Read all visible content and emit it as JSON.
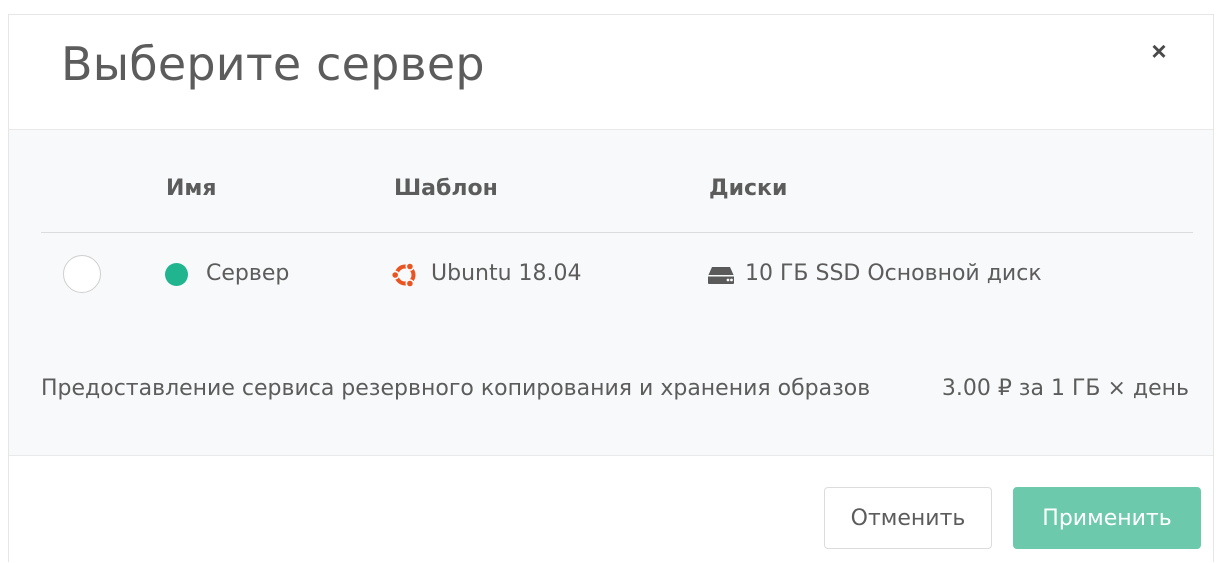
{
  "dialog": {
    "title": "Выберите сервер",
    "close_label": "×"
  },
  "table": {
    "headers": {
      "name": "Имя",
      "template": "Шаблон",
      "disks": "Диски"
    },
    "rows": [
      {
        "selected": false,
        "status_color": "#20b58f",
        "status_icon": "status-dot-active",
        "name": "Сервер",
        "template_icon": "ubuntu-icon",
        "template": "Ubuntu 18.04",
        "disk_icon": "hard-drive-icon",
        "disk": "10 ГБ SSD Основной диск"
      }
    ]
  },
  "service": {
    "label": "Предоставление сервиса резервного копирования и хранения образов",
    "price": "3.00 ₽  за 1 ГБ × день"
  },
  "footer": {
    "cancel_label": "Отменить",
    "apply_label": "Применить"
  },
  "colors": {
    "accent": "#6cc9ab",
    "status_active": "#20b58f",
    "ubuntu_orange": "#e95420"
  }
}
